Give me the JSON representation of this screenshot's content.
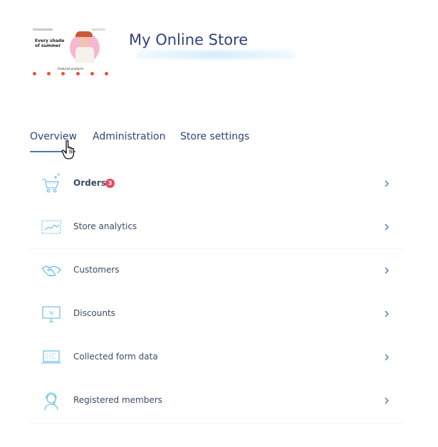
{
  "store": {
    "title": "My Online Store",
    "thumbnail": {
      "hero_text": "Every shade of summer",
      "featured_label": "Featured products"
    }
  },
  "tabs": [
    {
      "label": "Overview",
      "active": true
    },
    {
      "label": "Administration",
      "active": false
    },
    {
      "label": "Store settings",
      "active": false
    }
  ],
  "menu": [
    {
      "label": "Orders",
      "icon": "cart-icon",
      "badge": "3",
      "bold": true
    },
    {
      "label": "Store analytics",
      "icon": "analytics-icon"
    },
    {
      "label": "Customers",
      "icon": "handshake-icon"
    },
    {
      "label": "Discounts",
      "icon": "discount-icon"
    },
    {
      "label": "Collected form data",
      "icon": "form-data-icon"
    },
    {
      "label": "Registered members",
      "icon": "member-icon"
    }
  ],
  "colors": {
    "accent": "#4a78b5",
    "badge": "#e84a5f",
    "icon": "#5bb6e0",
    "title": "#34427a"
  }
}
